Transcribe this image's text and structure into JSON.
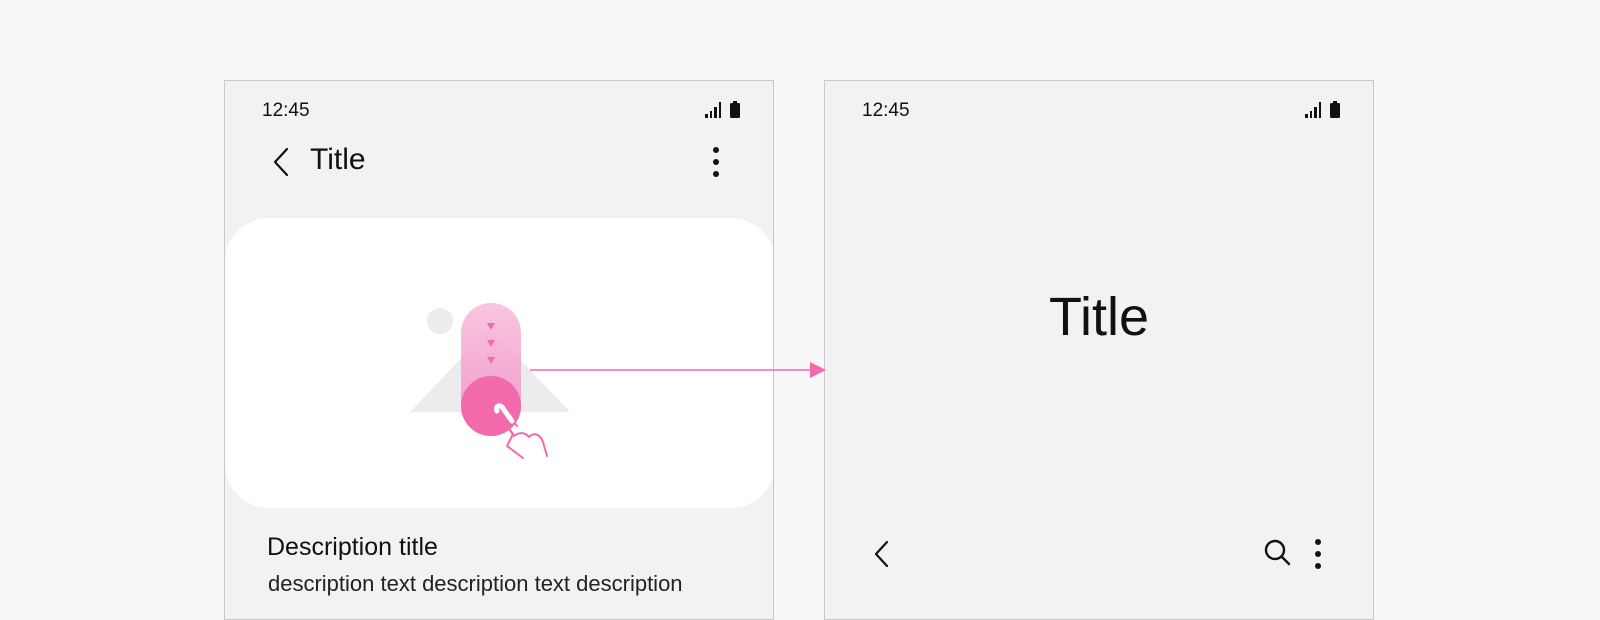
{
  "screens": {
    "left": {
      "status": {
        "time": "12:45"
      },
      "appbar": {
        "title": "Title"
      },
      "description": {
        "title": "Description title",
        "text": "description text description text description"
      }
    },
    "right": {
      "status": {
        "time": "12:45"
      },
      "title": "Title"
    }
  },
  "icons": {
    "status": [
      "signal-icon",
      "battery-icon"
    ],
    "appbar": [
      "back-arrow-icon",
      "more-vertical-icon"
    ],
    "bottom_bar": [
      "back-arrow-icon",
      "search-icon",
      "more-vertical-icon"
    ],
    "illustration": [
      "tap-gesture-icon",
      "hand-pointer-icon"
    ]
  },
  "colors": {
    "accent_pink": "#f26aac",
    "phone_background": "#f2f2f4",
    "card_background": "#ffffff"
  }
}
